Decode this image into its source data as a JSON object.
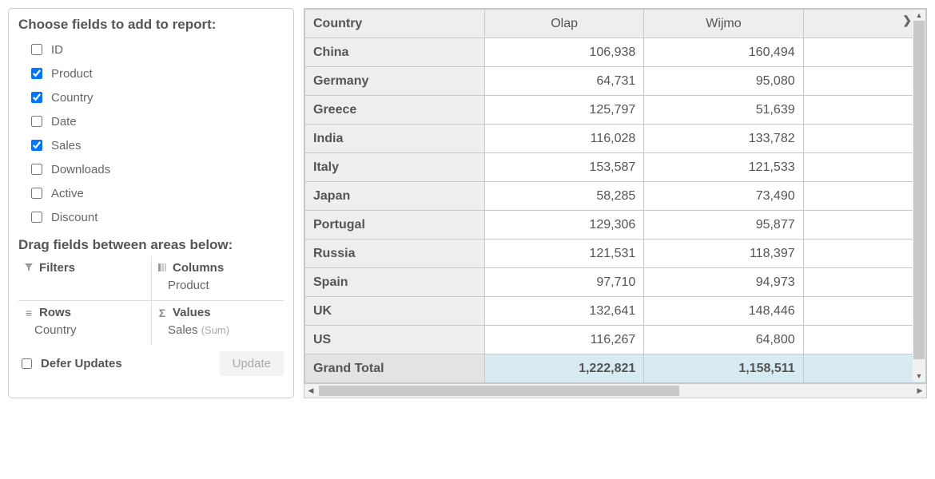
{
  "panel": {
    "choose_title": "Choose fields to add to report:",
    "fields": [
      {
        "label": "ID",
        "checked": false
      },
      {
        "label": "Product",
        "checked": true
      },
      {
        "label": "Country",
        "checked": true
      },
      {
        "label": "Date",
        "checked": false
      },
      {
        "label": "Sales",
        "checked": true
      },
      {
        "label": "Downloads",
        "checked": false
      },
      {
        "label": "Active",
        "checked": false
      },
      {
        "label": "Discount",
        "checked": false
      }
    ],
    "drag_title": "Drag fields between areas below:",
    "areas": {
      "filters": {
        "header": "Filters",
        "items": []
      },
      "columns": {
        "header": "Columns",
        "items": [
          "Product"
        ]
      },
      "rows": {
        "header": "Rows",
        "items": [
          "Country"
        ]
      },
      "values": {
        "header": "Values",
        "items": [
          {
            "label": "Sales",
            "suffix": "(Sum)"
          }
        ]
      }
    },
    "defer_label": "Defer Updates",
    "defer_checked": false,
    "update_label": "Update"
  },
  "grid": {
    "columns": [
      "Country",
      "Olap",
      "Wijmo"
    ],
    "rows": [
      {
        "header": "China",
        "values": [
          "106,938",
          "160,494"
        ]
      },
      {
        "header": "Germany",
        "values": [
          "64,731",
          "95,080"
        ]
      },
      {
        "header": "Greece",
        "values": [
          "125,797",
          "51,639"
        ]
      },
      {
        "header": "India",
        "values": [
          "116,028",
          "133,782"
        ]
      },
      {
        "header": "Italy",
        "values": [
          "153,587",
          "121,533"
        ]
      },
      {
        "header": "Japan",
        "values": [
          "58,285",
          "73,490"
        ]
      },
      {
        "header": "Portugal",
        "values": [
          "129,306",
          "95,877"
        ]
      },
      {
        "header": "Russia",
        "values": [
          "121,531",
          "118,397"
        ]
      },
      {
        "header": "Spain",
        "values": [
          "97,710",
          "94,973"
        ]
      },
      {
        "header": "UK",
        "values": [
          "132,641",
          "148,446"
        ]
      },
      {
        "header": "US",
        "values": [
          "116,267",
          "64,800"
        ]
      }
    ],
    "grand_total": {
      "header": "Grand Total",
      "values": [
        "1,222,821",
        "1,158,511"
      ]
    }
  }
}
